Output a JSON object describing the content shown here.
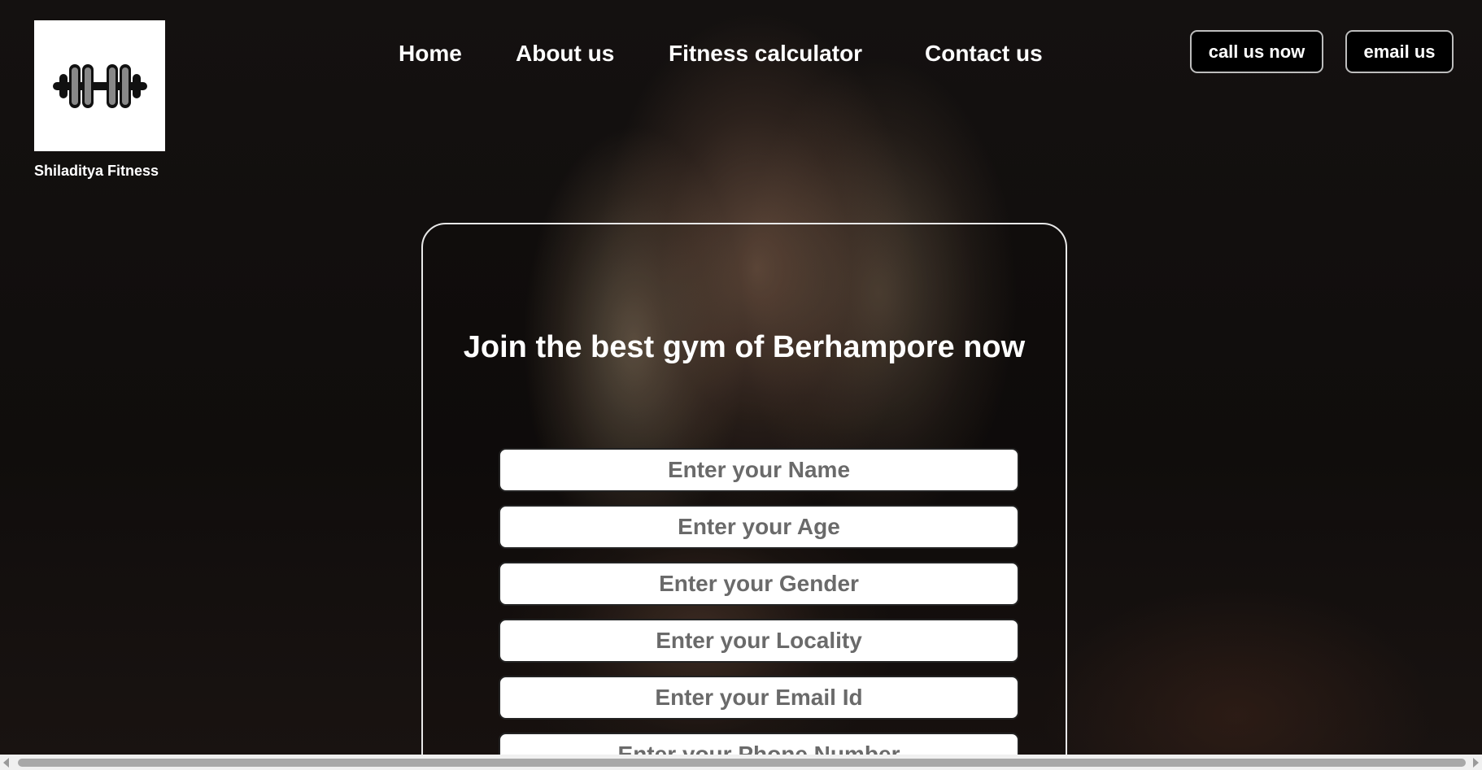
{
  "brand": {
    "name": "Shiladitya Fitness",
    "logo_icon": "dumbbell-icon"
  },
  "nav": {
    "items": [
      {
        "label": "Home"
      },
      {
        "label": "About us"
      },
      {
        "label": "Fitness calculator"
      },
      {
        "label": "Contact us"
      }
    ]
  },
  "actions": {
    "call_label": "call us now",
    "email_label": "email us"
  },
  "form": {
    "headline": "Join the best gym of Berhampore now",
    "fields": [
      {
        "placeholder": "Enter your Name"
      },
      {
        "placeholder": "Enter your Age"
      },
      {
        "placeholder": "Enter your Gender"
      },
      {
        "placeholder": "Enter your Locality"
      },
      {
        "placeholder": "Enter your Email Id"
      },
      {
        "placeholder": "Enter your Phone Number"
      }
    ]
  },
  "colors": {
    "background": "#0f0d0c",
    "text": "#ffffff",
    "button_bg": "#000000",
    "button_border": "#bdbdbd",
    "field_bg": "#ffffff",
    "placeholder": "#6a6a6a"
  }
}
